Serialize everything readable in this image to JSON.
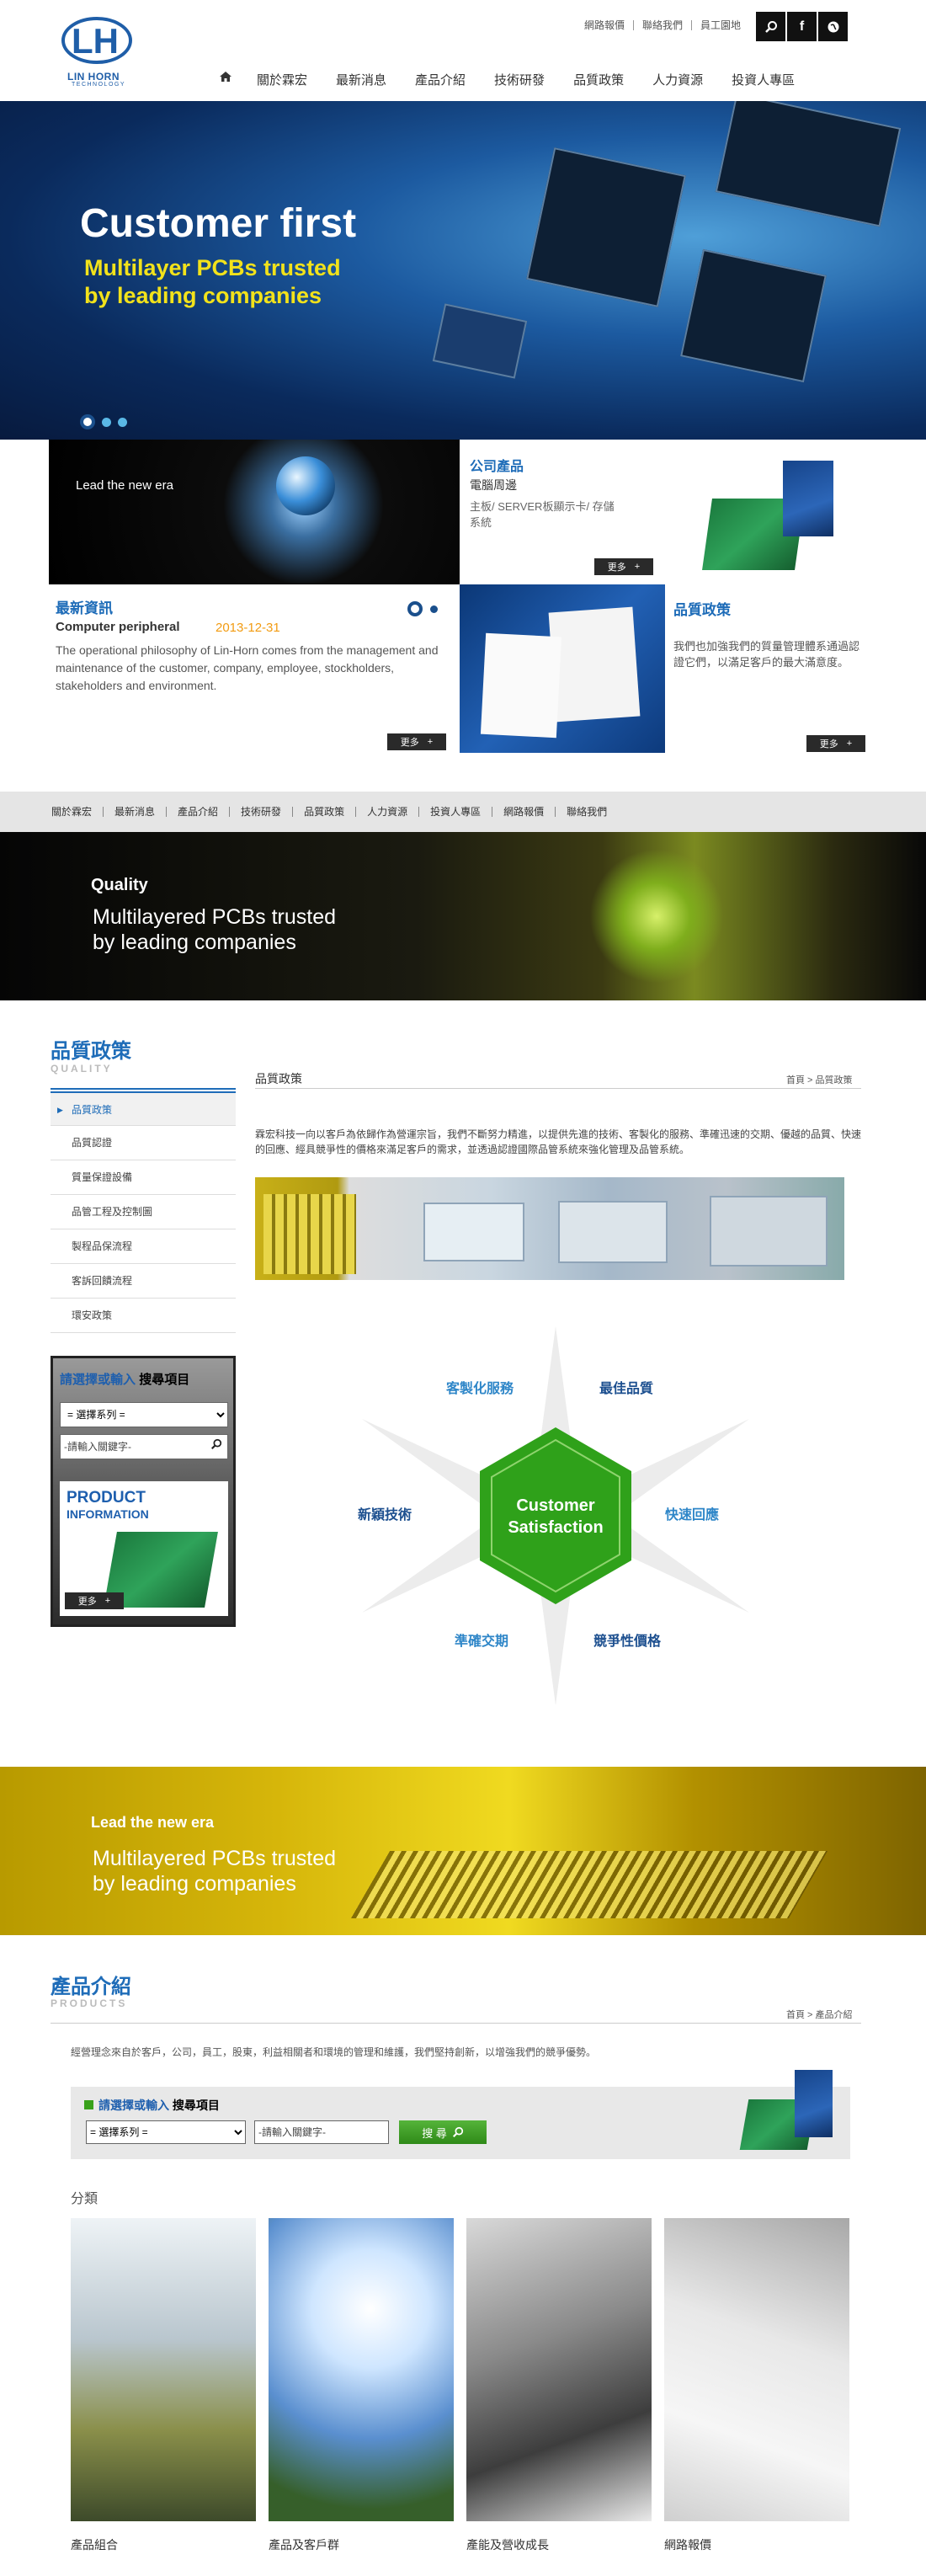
{
  "header": {
    "logo_text": "LIN HORN",
    "logo_sub": "TECHNOLOGY",
    "top_links": [
      "網路報價",
      "聯絡我們",
      "員工園地"
    ],
    "nav": [
      "關於霖宏",
      "最新消息",
      "產品介紹",
      "技術研發",
      "品質政策",
      "人力資源",
      "投資人專區"
    ]
  },
  "hero": {
    "headline": "Customer first",
    "subline_1": "Multilayer PCBs trusted",
    "subline_2": "by leading companies"
  },
  "features": {
    "lead_caption": "Lead the new era",
    "news_title": "最新資訊",
    "news_item": "Computer peripheral",
    "news_date": "2013-12-31",
    "news_body": "The operational philosophy of Lin-Horn comes from the management and maintenance of the customer, company, employee, stockholders, stakeholders and environment.",
    "product_title": "公司產品",
    "product_sub": "電腦周邊",
    "product_desc": "主板/ SERVER板顯示卡/ 存儲系統",
    "quality_title": "品質政策",
    "quality_desc": "我們也加強我們的質量管理體系通過認證它們，以滿足客戶的最大滿意度。",
    "more": "更多"
  },
  "sub_nav": [
    "關於霖宏",
    "最新消息",
    "產品介紹",
    "技術研發",
    "品質政策",
    "人力資源",
    "投資人專區",
    "網路報價",
    "聯絡我們"
  ],
  "banner2": {
    "tag": "Quality",
    "line_1": "Multilayered PCBs trusted",
    "line_2": "by leading companies"
  },
  "sidebar": {
    "title": "品質政策",
    "subtitle": "QUALITY",
    "items": [
      "品質政策",
      "品質認證",
      "質量保證設備",
      "品管工程及控制圖",
      "製程品保流程",
      "客訴回饋流程",
      "環安政策"
    ],
    "search_title_blue": "請選擇或輸入",
    "search_title_dark": "搜尋項目",
    "select_value": "= 選擇系列 =",
    "input_placeholder": "-請輸入關鍵字-",
    "product_info_1": "PRODUCT",
    "product_info_2": "INFORMATION"
  },
  "quality": {
    "heading": "品質政策",
    "breadcrumb_home": "首頁",
    "breadcrumb_current": "品質政策",
    "paragraph": "霖宏科技一向以客戶為依歸作為營運宗旨，我們不斷努力精進，以提供先進的技術、客製化的服務、準確迅速的交期、優越的品質、快速的回應、經具競爭性的價格來滿足客戶的需求，並透過認證國際品管系統來強化管理及品管系統。",
    "center_1": "Customer",
    "center_2": "Satisfaction",
    "spokes": [
      "客製化服務",
      "最佳品質",
      "快速回應",
      "競爭性價格",
      "準確交期",
      "新穎技術"
    ]
  },
  "banner3": {
    "tag": "Lead the new era",
    "line_1": "Multilayered PCBs trusted",
    "line_2": "by leading companies"
  },
  "products": {
    "title": "產品介紹",
    "subtitle": "PRODUCTS",
    "breadcrumb_home": "首頁",
    "breadcrumb_current": "產品介紹",
    "intro": "經營理念來自於客戶，公司，員工，股東，利益相關者和環境的管理和維護，我們堅持創新，以增強我們的競爭優勢。",
    "search_title_blue": "請選擇或輸入",
    "search_title_dark": "搜尋項目",
    "select_value": "= 選擇系列 =",
    "input_placeholder": "-請輸入關鍵字-",
    "search_button": "搜 尋",
    "category_label": "分類",
    "categories": [
      "產品組合",
      "產品及客戶群",
      "產能及營收成長",
      "網路報價"
    ]
  }
}
